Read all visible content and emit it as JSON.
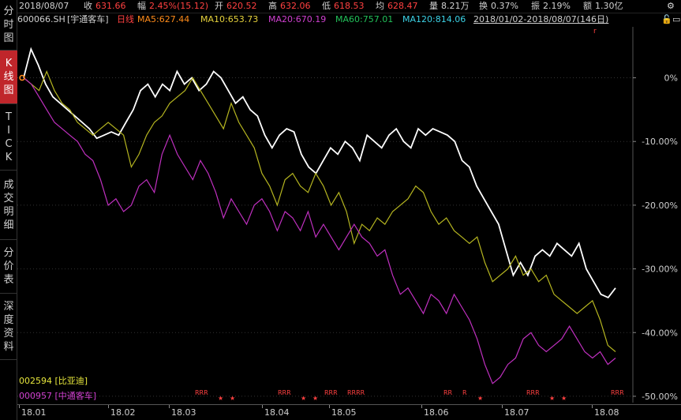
{
  "sidebar": {
    "tabs": [
      {
        "label": "分时图",
        "chars": [
          "分",
          "时",
          "图"
        ],
        "active": false
      },
      {
        "label": "K线图",
        "chars": [
          "K",
          "线",
          "图"
        ],
        "active": true
      },
      {
        "label": "TICK",
        "chars": [
          "T",
          "I",
          "C",
          "K"
        ],
        "active": false
      },
      {
        "label": "成交明细",
        "chars": [
          "成",
          "交",
          "明",
          "细"
        ],
        "active": false
      },
      {
        "label": "分价表",
        "chars": [
          "分",
          "价",
          "表"
        ],
        "active": false
      },
      {
        "label": "深度资料",
        "chars": [
          "深",
          "度",
          "资",
          "料"
        ],
        "active": false
      }
    ]
  },
  "quote": {
    "date": "2018/08/07",
    "close_label": "收",
    "close": "631.66",
    "change_label": "幅",
    "change": "2.45%(15.12)",
    "open_label": "开",
    "open": "620.52",
    "high_label": "高",
    "high": "632.06",
    "low_label": "低",
    "low": "618.53",
    "avg_label": "均",
    "avg": "628.47",
    "volume_label": "量",
    "volume": "8.21万",
    "turnover_label": "换",
    "turnover": "0.37%",
    "amplitude_label": "振",
    "amplitude": "2.19%",
    "amount_label": "额",
    "amount": "1.30亿"
  },
  "indicators": {
    "code": "600066.SH",
    "name": "[宇通客车]",
    "period": "日线",
    "ma5": "MA5:627.44",
    "ma10": "MA10:653.73",
    "ma20": "MA20:670.19",
    "ma60": "MA60:757.01",
    "ma120": "MA120:814.06",
    "range": "2018/01/02-2018/08/07(146日)"
  },
  "colors": {
    "main": "#ffffff",
    "compare1": "#b5b520",
    "compare2": "#c030c0",
    "ma5": "#ff8c1a",
    "ma10": "#e6d23c",
    "ma20": "#d040d0",
    "ma60": "#22c25a",
    "ma120": "#3cd2e6",
    "up": "#ff4040",
    "grid": "#333333"
  },
  "legend": [
    {
      "code": "002594",
      "name": "[比亚迪]",
      "color": "#e6e63c"
    },
    {
      "code": "000957",
      "name": "[中通客车]",
      "color": "#d040d0"
    }
  ],
  "chart_data": {
    "type": "line",
    "x": [
      "18.01",
      "18.02",
      "18.03",
      "18.04",
      "18.05",
      "18.06",
      "18.07",
      "18.08"
    ],
    "ylim": [
      -51,
      8
    ],
    "yticks": [
      0,
      -10,
      -20,
      -30,
      -40,
      -50
    ],
    "ytick_labels": [
      "0%",
      "-10.00%",
      "-20.00%",
      "-30.00%",
      "-40.00%",
      "-50.00%"
    ],
    "series": [
      {
        "key": "main",
        "color": "#ffffff",
        "values": [
          0,
          4.5,
          2,
          -1,
          -3,
          -4,
          -5,
          -6,
          -7,
          -8,
          -9.5,
          -9,
          -8.5,
          -9,
          -7,
          -5,
          -2,
          -1,
          -3,
          -1,
          -2,
          1,
          -1,
          0,
          -2,
          -1,
          1,
          0,
          -2,
          -4,
          -3,
          -5,
          -6,
          -9,
          -11,
          -9,
          -8,
          -8.5,
          -12,
          -14,
          -15,
          -13,
          -11,
          -12,
          -10,
          -11,
          -13,
          -9,
          -10,
          -11,
          -9,
          -8,
          -10,
          -11,
          -8,
          -9,
          -8,
          -8.5,
          -9,
          -10,
          -13,
          -14,
          -17,
          -19,
          -21,
          -23,
          -27,
          -31,
          -29,
          -31,
          -28,
          -27,
          -28,
          -26,
          -27,
          -28,
          -26,
          -30,
          -32,
          -34,
          -34.5,
          -33
        ]
      },
      {
        "key": "compare1",
        "color": "#b5b520",
        "values": [
          0,
          -1,
          -2,
          1,
          -2,
          -4,
          -5,
          -7,
          -8,
          -9,
          -8,
          -7,
          -8,
          -9,
          -14,
          -12,
          -9,
          -7,
          -6,
          -4,
          -3,
          -2,
          0,
          -2,
          -4,
          -6,
          -8,
          -4,
          -7,
          -9,
          -11,
          -15,
          -17,
          -20,
          -16,
          -15,
          -17,
          -18,
          -15,
          -17,
          -20,
          -18,
          -21,
          -26,
          -23,
          -24,
          -22,
          -23,
          -21,
          -20,
          -19,
          -17,
          -18,
          -21,
          -23,
          -22,
          -24,
          -25,
          -26,
          -25,
          -29,
          -32,
          -31,
          -30,
          -28,
          -31,
          -30,
          -32,
          -31,
          -34,
          -35,
          -36,
          -37,
          -36,
          -35,
          -38,
          -42,
          -43
        ]
      },
      {
        "key": "compare2",
        "color": "#c030c0",
        "values": [
          0,
          -1,
          -3,
          -5,
          -7,
          -8,
          -9,
          -10,
          -12,
          -13,
          -16,
          -20,
          -19,
          -21,
          -20,
          -17,
          -16,
          -18,
          -12,
          -9,
          -12,
          -14,
          -16,
          -13,
          -15,
          -18,
          -22,
          -19,
          -21,
          -23,
          -20,
          -19,
          -21,
          -24,
          -21,
          -22,
          -24,
          -21,
          -25,
          -23,
          -25,
          -27,
          -25,
          -23,
          -25,
          -26,
          -28,
          -27,
          -31,
          -34,
          -33,
          -35,
          -37,
          -34,
          -35,
          -37,
          -34,
          -36,
          -38,
          -41,
          -45,
          -48,
          -47,
          -45,
          -44,
          -41,
          -40,
          -42,
          -43,
          -42,
          -41,
          -39,
          -41,
          -43,
          -44,
          -43,
          -45,
          -44
        ]
      }
    ],
    "markers": [
      {
        "x": "18.03",
        "labels": [
          "RRR",
          "★",
          "★"
        ]
      },
      {
        "x": "18.04",
        "labels": [
          "RRR",
          "★",
          "★",
          "RRR",
          "RRRR"
        ]
      },
      {
        "x": "18.06",
        "labels": [
          "RR",
          "R",
          "★"
        ]
      },
      {
        "x": "18.07",
        "labels": [
          "RRR",
          "★",
          "★"
        ]
      },
      {
        "x": "18.08",
        "labels": [
          "RRR"
        ]
      }
    ],
    "marker_top": "r"
  }
}
